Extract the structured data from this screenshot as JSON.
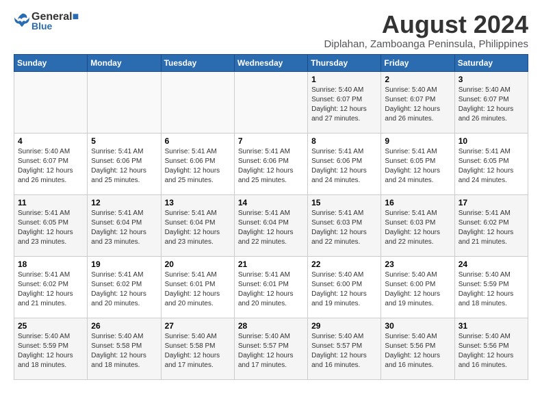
{
  "header": {
    "logo_line1": "General",
    "logo_line2": "Blue",
    "title": "August 2024",
    "subtitle": "Diplahan, Zamboanga Peninsula, Philippines"
  },
  "weekdays": [
    "Sunday",
    "Monday",
    "Tuesday",
    "Wednesday",
    "Thursday",
    "Friday",
    "Saturday"
  ],
  "weeks": [
    [
      {
        "day": "",
        "info": ""
      },
      {
        "day": "",
        "info": ""
      },
      {
        "day": "",
        "info": ""
      },
      {
        "day": "",
        "info": ""
      },
      {
        "day": "1",
        "info": "Sunrise: 5:40 AM\nSunset: 6:07 PM\nDaylight: 12 hours and 27 minutes."
      },
      {
        "day": "2",
        "info": "Sunrise: 5:40 AM\nSunset: 6:07 PM\nDaylight: 12 hours and 26 minutes."
      },
      {
        "day": "3",
        "info": "Sunrise: 5:40 AM\nSunset: 6:07 PM\nDaylight: 12 hours and 26 minutes."
      }
    ],
    [
      {
        "day": "4",
        "info": "Sunrise: 5:40 AM\nSunset: 6:07 PM\nDaylight: 12 hours and 26 minutes."
      },
      {
        "day": "5",
        "info": "Sunrise: 5:41 AM\nSunset: 6:06 PM\nDaylight: 12 hours and 25 minutes."
      },
      {
        "day": "6",
        "info": "Sunrise: 5:41 AM\nSunset: 6:06 PM\nDaylight: 12 hours and 25 minutes."
      },
      {
        "day": "7",
        "info": "Sunrise: 5:41 AM\nSunset: 6:06 PM\nDaylight: 12 hours and 25 minutes."
      },
      {
        "day": "8",
        "info": "Sunrise: 5:41 AM\nSunset: 6:06 PM\nDaylight: 12 hours and 24 minutes."
      },
      {
        "day": "9",
        "info": "Sunrise: 5:41 AM\nSunset: 6:05 PM\nDaylight: 12 hours and 24 minutes."
      },
      {
        "day": "10",
        "info": "Sunrise: 5:41 AM\nSunset: 6:05 PM\nDaylight: 12 hours and 24 minutes."
      }
    ],
    [
      {
        "day": "11",
        "info": "Sunrise: 5:41 AM\nSunset: 6:05 PM\nDaylight: 12 hours and 23 minutes."
      },
      {
        "day": "12",
        "info": "Sunrise: 5:41 AM\nSunset: 6:04 PM\nDaylight: 12 hours and 23 minutes."
      },
      {
        "day": "13",
        "info": "Sunrise: 5:41 AM\nSunset: 6:04 PM\nDaylight: 12 hours and 23 minutes."
      },
      {
        "day": "14",
        "info": "Sunrise: 5:41 AM\nSunset: 6:04 PM\nDaylight: 12 hours and 22 minutes."
      },
      {
        "day": "15",
        "info": "Sunrise: 5:41 AM\nSunset: 6:03 PM\nDaylight: 12 hours and 22 minutes."
      },
      {
        "day": "16",
        "info": "Sunrise: 5:41 AM\nSunset: 6:03 PM\nDaylight: 12 hours and 22 minutes."
      },
      {
        "day": "17",
        "info": "Sunrise: 5:41 AM\nSunset: 6:02 PM\nDaylight: 12 hours and 21 minutes."
      }
    ],
    [
      {
        "day": "18",
        "info": "Sunrise: 5:41 AM\nSunset: 6:02 PM\nDaylight: 12 hours and 21 minutes."
      },
      {
        "day": "19",
        "info": "Sunrise: 5:41 AM\nSunset: 6:02 PM\nDaylight: 12 hours and 20 minutes."
      },
      {
        "day": "20",
        "info": "Sunrise: 5:41 AM\nSunset: 6:01 PM\nDaylight: 12 hours and 20 minutes."
      },
      {
        "day": "21",
        "info": "Sunrise: 5:41 AM\nSunset: 6:01 PM\nDaylight: 12 hours and 20 minutes."
      },
      {
        "day": "22",
        "info": "Sunrise: 5:40 AM\nSunset: 6:00 PM\nDaylight: 12 hours and 19 minutes."
      },
      {
        "day": "23",
        "info": "Sunrise: 5:40 AM\nSunset: 6:00 PM\nDaylight: 12 hours and 19 minutes."
      },
      {
        "day": "24",
        "info": "Sunrise: 5:40 AM\nSunset: 5:59 PM\nDaylight: 12 hours and 18 minutes."
      }
    ],
    [
      {
        "day": "25",
        "info": "Sunrise: 5:40 AM\nSunset: 5:59 PM\nDaylight: 12 hours and 18 minutes."
      },
      {
        "day": "26",
        "info": "Sunrise: 5:40 AM\nSunset: 5:58 PM\nDaylight: 12 hours and 18 minutes."
      },
      {
        "day": "27",
        "info": "Sunrise: 5:40 AM\nSunset: 5:58 PM\nDaylight: 12 hours and 17 minutes."
      },
      {
        "day": "28",
        "info": "Sunrise: 5:40 AM\nSunset: 5:57 PM\nDaylight: 12 hours and 17 minutes."
      },
      {
        "day": "29",
        "info": "Sunrise: 5:40 AM\nSunset: 5:57 PM\nDaylight: 12 hours and 16 minutes."
      },
      {
        "day": "30",
        "info": "Sunrise: 5:40 AM\nSunset: 5:56 PM\nDaylight: 12 hours and 16 minutes."
      },
      {
        "day": "31",
        "info": "Sunrise: 5:40 AM\nSunset: 5:56 PM\nDaylight: 12 hours and 16 minutes."
      }
    ]
  ]
}
